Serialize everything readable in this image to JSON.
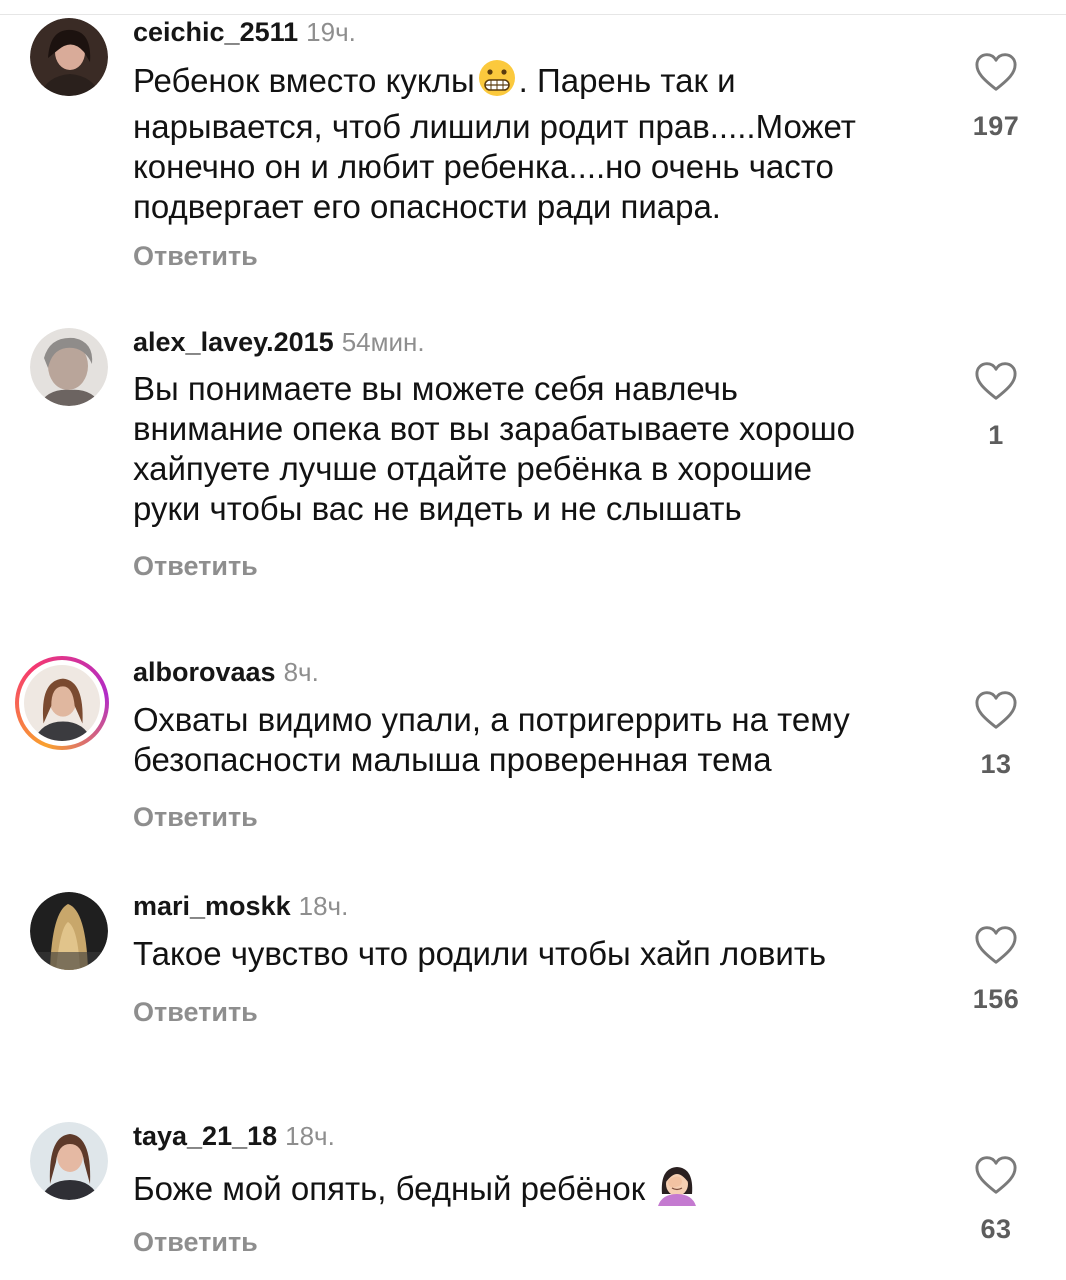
{
  "comments": [
    {
      "username": "ceichic_2511",
      "time": "19ч.",
      "text": "Ребенок вместо куклы",
      "emoji": "grimacing-face",
      "text_after": ". Парень так и",
      "text_rest": "нарывается, чтоб лишили родит прав.....Может\nконечно он и любит ребенка....но очень часто\nподвергает его опасности ради пиара.",
      "reply": "Ответить",
      "likes": "197",
      "avatar_ring": false,
      "avatar_colors": [
        "#2b1e1a",
        "#c9998a"
      ]
    },
    {
      "username": "alex_lavey.2015",
      "time": "54мин.",
      "text": "Вы понимаете вы можете себя навлечь\nвнимание опека вот вы зарабатываете хорошо\nхайпуете лучше отдайте ребёнка в хорошие\nруки чтобы вас не видеть и не слышать",
      "reply": "Ответить",
      "likes": "1",
      "avatar_ring": false,
      "avatar_colors": [
        "#d6d2cf",
        "#9c8f88"
      ]
    },
    {
      "username": "alborovaas",
      "time": "8ч.",
      "text": "Охваты видимо упали, а потригеррить на тему\nбезопасности малыша проверенная тема",
      "reply": "Ответить",
      "likes": "13",
      "avatar_ring": true,
      "avatar_colors": [
        "#6b4a3a",
        "#d8b6a0"
      ]
    },
    {
      "username": "mari_moskk",
      "time": "18ч.",
      "text": "Такое чувство что родили чтобы хайп ловить",
      "reply": "Ответить",
      "likes": "156",
      "avatar_ring": false,
      "avatar_colors": [
        "#2a2a2a",
        "#c3a46c"
      ]
    },
    {
      "username": "taya_21_18",
      "time": "18ч.",
      "text": "Боже мой опять, бедный ребёнок",
      "emoji": "woman-facepalming",
      "reply": "Ответить",
      "likes": "63",
      "avatar_ring": false,
      "avatar_colors": [
        "#dfe6ea",
        "#5e3a2a"
      ]
    }
  ],
  "icons": {
    "like": "heart-outline-icon"
  },
  "colors": {
    "text": "#121212",
    "secondary": "#8e8e8e",
    "heart": "#7a7a7a"
  }
}
